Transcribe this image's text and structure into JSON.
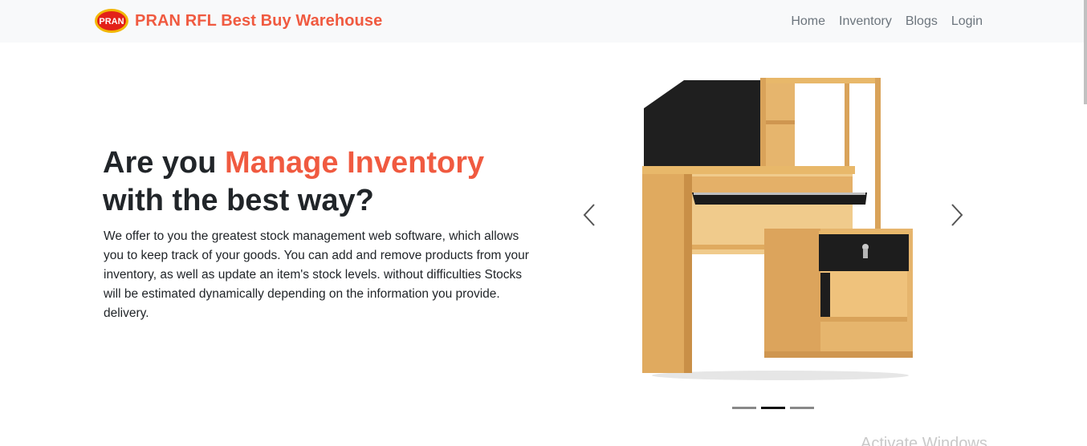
{
  "navbar": {
    "brand_logo_text": "PRAN",
    "brand_name": "PRAN RFL Best Buy Warehouse",
    "links": [
      "Home",
      "Inventory",
      "Blogs",
      "Login"
    ]
  },
  "hero": {
    "title_prefix": "Are you ",
    "title_accent": "Manage Inventory",
    "title_suffix": "with the best way?",
    "description": "We offer to you the greatest stock management web software, which allows you to keep track of your goods. You can add and remove products from your inventory, as well as update an item's stock levels. without difficulties Stocks will be estimated dynamically depending on the information you provide. delivery."
  },
  "carousel": {
    "slides_count": 3,
    "active_index": 1,
    "prev_icon": "chevron-left-icon",
    "next_icon": "chevron-right-icon"
  },
  "watermark": "Activate Windows",
  "colors": {
    "accent": "#f05a40",
    "navbar_bg": "#f8f9fa",
    "nav_link": "#6c757d"
  }
}
